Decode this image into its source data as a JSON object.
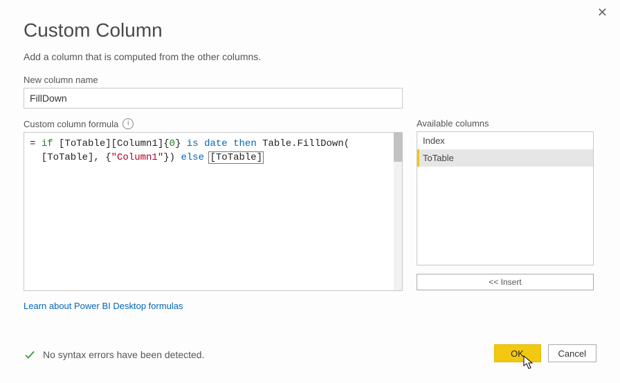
{
  "dialog": {
    "title": "Custom Column",
    "subtitle": "Add a column that is computed from the other columns.",
    "close_glyph": "✕"
  },
  "column_name": {
    "label": "New column name",
    "value": "FillDown"
  },
  "formula": {
    "label": "Custom column formula",
    "info_glyph": "i",
    "prefix": "= ",
    "tokens": {
      "t0": "if",
      "t1": " [ToTable][Column1]{",
      "t2": "0",
      "t3": "} ",
      "t4": "is",
      "t5": " ",
      "t6": "date",
      "t7": " ",
      "t8": "then",
      "t9": " Table.FillDown(",
      "t10": "  [ToTable], {",
      "t11": "\"Column1\"",
      "t12": "}) ",
      "t13": "else",
      "t14": " ",
      "t15": "[ToTable]"
    },
    "learn_link": "Learn about Power BI Desktop formulas"
  },
  "available": {
    "label": "Available columns",
    "items": [
      {
        "name": "Index",
        "selected": false
      },
      {
        "name": "ToTable",
        "selected": true
      }
    ],
    "insert_label": "<< Insert"
  },
  "status": {
    "message": "No syntax errors have been detected."
  },
  "buttons": {
    "ok": "OK",
    "cancel": "Cancel"
  }
}
